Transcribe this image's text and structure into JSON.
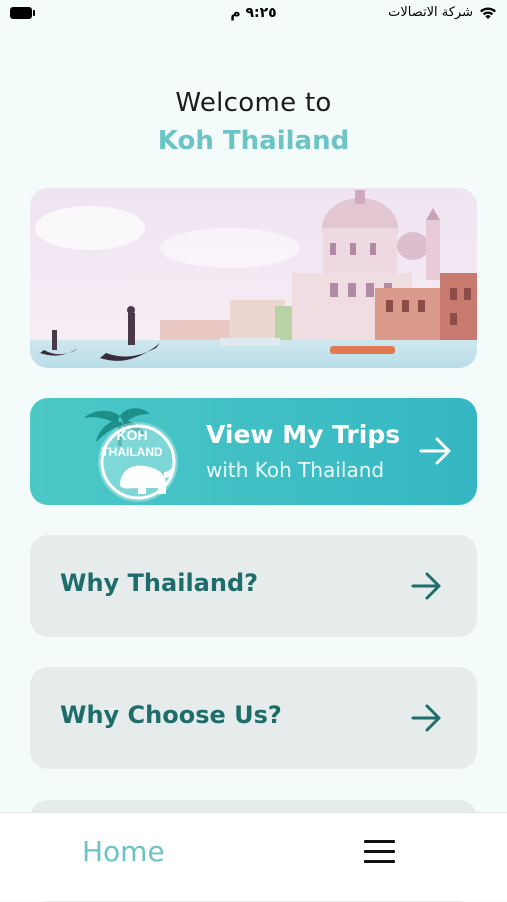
{
  "status_bar": {
    "time": "٩:٢٥ م",
    "carrier": "شركة الاتصالات"
  },
  "welcome": {
    "greeting": "Welcome to",
    "brand_name": "Koh Thailand"
  },
  "trips_button": {
    "title": "View My Trips",
    "subtitle": "with Koh Thailand",
    "logo_text_line1": "KOH",
    "logo_text_line2": "THAILAND"
  },
  "menu": {
    "items": [
      {
        "label": "Why Thailand?"
      },
      {
        "label": "Why Choose Us?"
      },
      {
        "label": ""
      }
    ]
  },
  "bottom_nav": {
    "home_label": "Home",
    "menu_icon": "hamburger-icon"
  },
  "colors": {
    "accent": "#6cc4c4",
    "trips_gradient_start": "#4cc8c6",
    "trips_gradient_end": "#35b7c3",
    "card_bg": "#e6ecec",
    "card_text": "#1f6d6a",
    "page_bg": "#f3fbfb"
  }
}
